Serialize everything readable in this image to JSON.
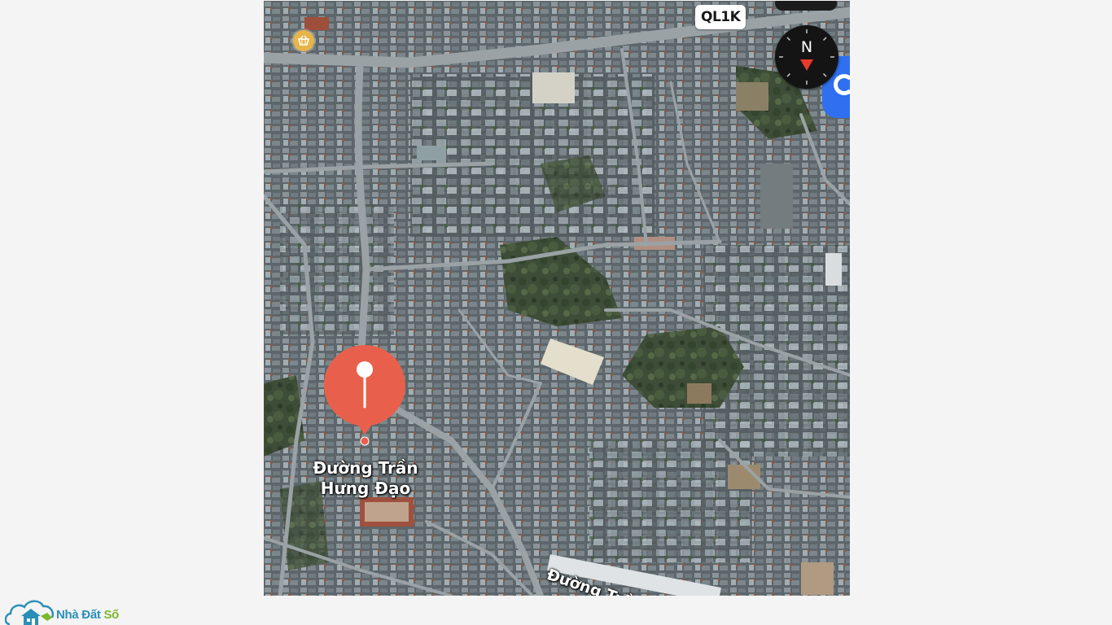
{
  "map": {
    "road_badge": "QL1K",
    "compass_letter": "N",
    "pin_label_line1": "Đường Trần",
    "pin_label_line2": "Hưng Đạo",
    "street_label": "Đường Trần Hưng Đạo",
    "pin_color": "#e8604c",
    "location_color": "#2f6ff0",
    "poi_icon": "basket-icon"
  },
  "logo": {
    "text_part1": "Nhà Đất ",
    "text_part2": "Số",
    "color1": "#2a8fb8",
    "color2": "#7ab82e"
  }
}
